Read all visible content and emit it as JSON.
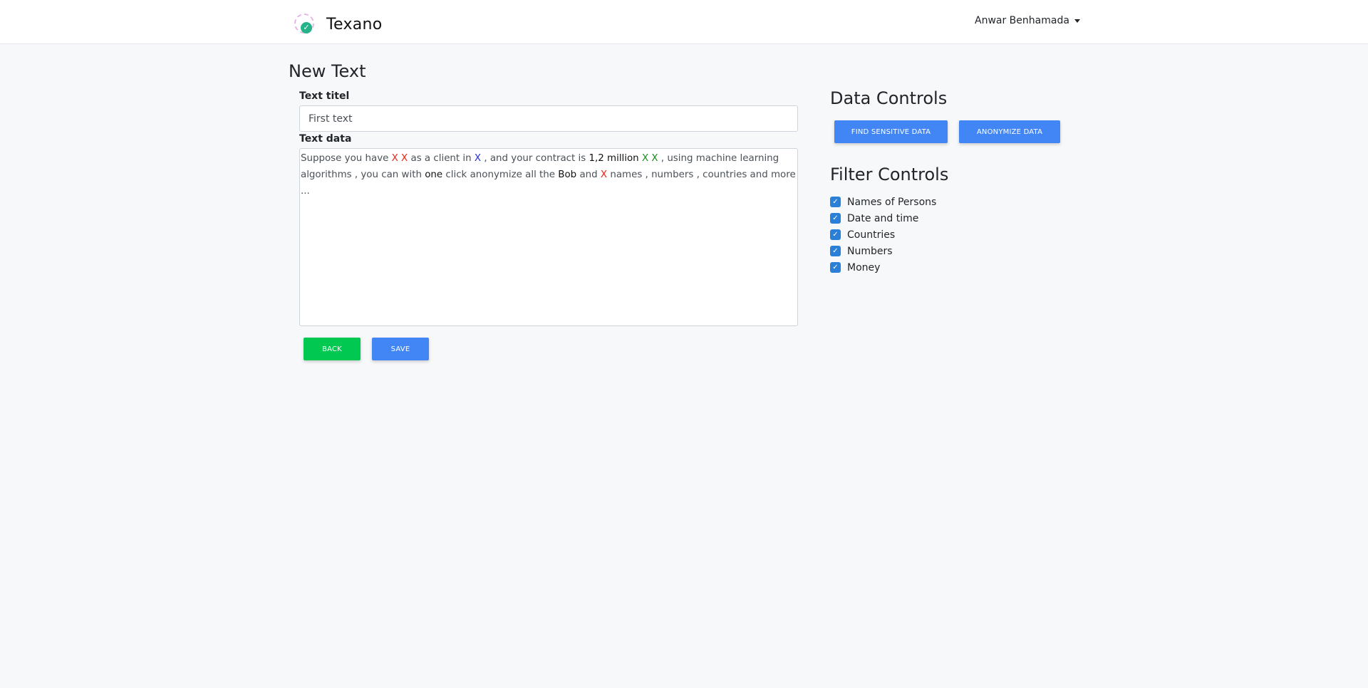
{
  "navbar": {
    "brand": "Texano",
    "user": "Anwar Benhamada"
  },
  "page": {
    "title": "New Text",
    "title_label": "Text titel",
    "title_value": "First text",
    "data_label": "Text data",
    "text_tokens": [
      {
        "text": "Suppose you have ",
        "style": "plain"
      },
      {
        "text": "X X",
        "style": "red"
      },
      {
        "text": " as a client in ",
        "style": "plain"
      },
      {
        "text": "X",
        "style": "blue"
      },
      {
        "text": " , and your contract is ",
        "style": "plain"
      },
      {
        "text": "1,2 million",
        "style": "black"
      },
      {
        "text": " ",
        "style": "plain"
      },
      {
        "text": "X X",
        "style": "green"
      },
      {
        "text": " , using machine learning algorithms , you can with ",
        "style": "plain"
      },
      {
        "text": "one",
        "style": "black"
      },
      {
        "text": " click anonymize all the ",
        "style": "plain"
      },
      {
        "text": "Bob",
        "style": "black"
      },
      {
        "text": " and ",
        "style": "plain"
      },
      {
        "text": "X",
        "style": "red"
      },
      {
        "text": " names , numbers , countries and more ...",
        "style": "plain"
      }
    ],
    "back_label": "BACK",
    "save_label": "SAVE"
  },
  "data_controls": {
    "title": "Data Controls",
    "find_label": "FIND SENSITIVE DATA",
    "anonymize_label": "ANONYMIZE DATA"
  },
  "filter_controls": {
    "title": "Filter Controls",
    "items": [
      {
        "label": "Names of Persons",
        "checked": true
      },
      {
        "label": "Date and time",
        "checked": true
      },
      {
        "label": "Countries",
        "checked": true
      },
      {
        "label": "Numbers",
        "checked": true
      },
      {
        "label": "Money",
        "checked": true
      }
    ]
  },
  "colors": {
    "accent_blue": "#4285f4",
    "accent_green": "#00c851",
    "checkbox": "#2a7fd6",
    "entity_person": "#e8261a",
    "entity_country": "#1f2cf0",
    "entity_money": "#1b8a1f"
  }
}
